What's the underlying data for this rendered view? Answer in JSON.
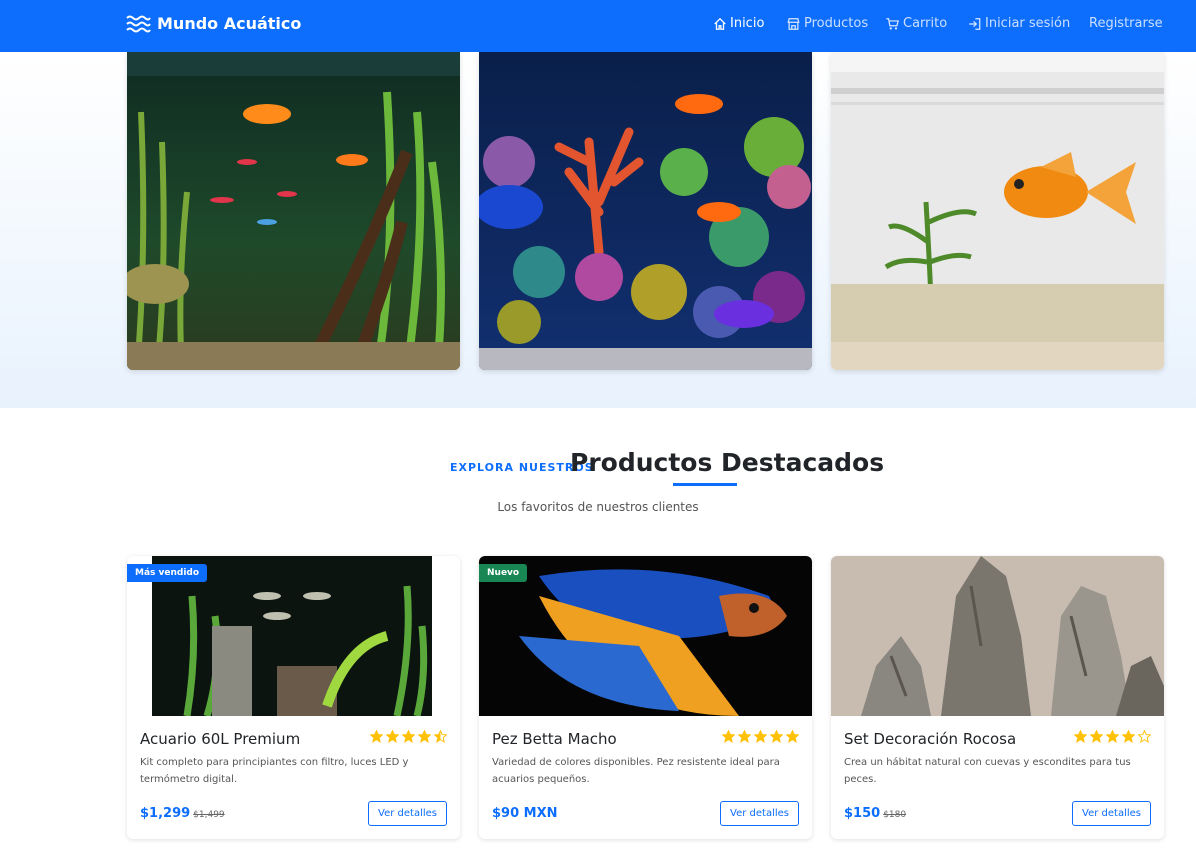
{
  "brand": {
    "name": "Mundo Acuático",
    "icon": "waves-icon"
  },
  "nav": {
    "items": [
      {
        "label": "Inicio",
        "icon": "home-icon",
        "active": true
      },
      {
        "label": "Productos",
        "icon": "store-icon",
        "active": false
      },
      {
        "label": "Carrito",
        "icon": "cart-icon",
        "active": false
      },
      {
        "label": "Iniciar sesión",
        "icon": "login-icon",
        "active": false
      },
      {
        "label": "Registrarse",
        "icon": "",
        "active": false
      }
    ]
  },
  "hero": {
    "images": [
      "freshwater-aquarium-image",
      "reef-aquarium-image",
      "goldfish-tank-image"
    ]
  },
  "featured": {
    "eyebrow": "EXPLORA NUESTROS",
    "title": "Productos Destacados",
    "subtitle": "Los favoritos de nuestros clientes"
  },
  "products": [
    {
      "name": "Acuario 60L Premium",
      "badge": "Más vendido",
      "rating": 4.5,
      "description": "Kit completo para principiantes con filtro, luces LED y termómetro digital.",
      "price": "$1,299",
      "old_price": "$1,499",
      "button": "Ver detalles"
    },
    {
      "name": "Pez Betta Macho",
      "badge": "Nuevo",
      "rating": 5,
      "description": "Variedad de colores disponibles. Pez resistente ideal para acuarios pequeños.",
      "price": "$90 MXN",
      "old_price": "",
      "button": "Ver detalles"
    },
    {
      "name": "Set Decoración Rocosa",
      "badge": "",
      "rating": 4,
      "description": "Crea un hábitat natural con cuevas y escondites para tus peces.",
      "price": "$150",
      "old_price": "$180",
      "button": "Ver detalles"
    }
  ],
  "colors": {
    "primary": "#0d6efd",
    "success": "#198754",
    "star": "#ffc107"
  }
}
